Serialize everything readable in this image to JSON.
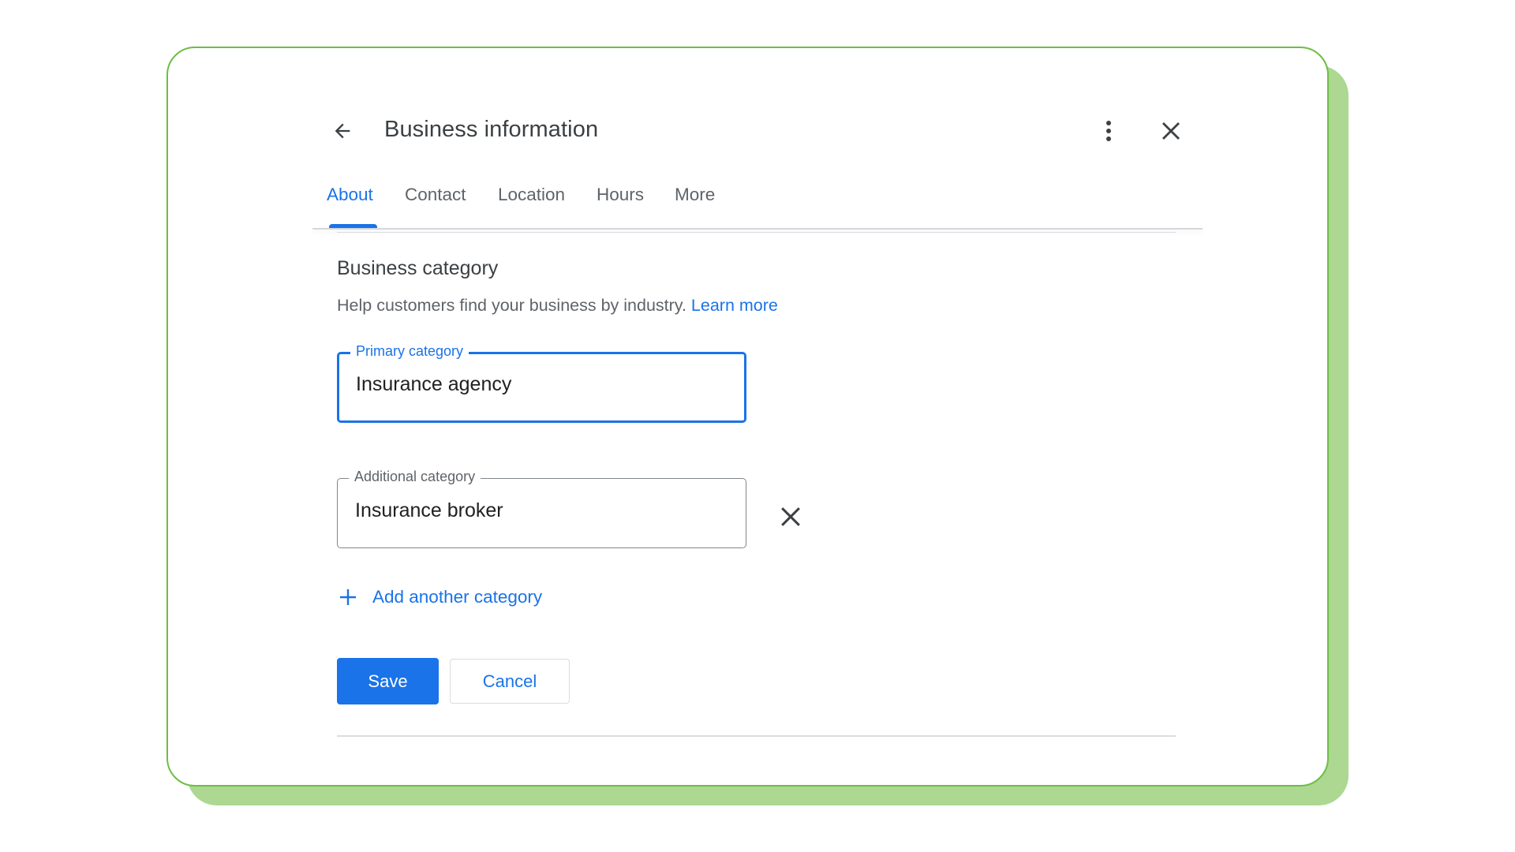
{
  "header": {
    "title": "Business information",
    "back_icon": "arrow-back-icon",
    "more_icon": "more-vert-icon",
    "close_icon": "close-icon"
  },
  "tabs": [
    {
      "label": "About",
      "active": true
    },
    {
      "label": "Contact",
      "active": false
    },
    {
      "label": "Location",
      "active": false
    },
    {
      "label": "Hours",
      "active": false
    },
    {
      "label": "More",
      "active": false
    }
  ],
  "section": {
    "title": "Business category",
    "help_text": "Help customers find your business by industry.",
    "learn_more": "Learn more"
  },
  "fields": {
    "primary": {
      "label": "Primary category",
      "value": "Insurance agency"
    },
    "additional": {
      "label": "Additional category",
      "value": "Insurance broker",
      "remove_icon": "close-icon"
    }
  },
  "add_category": {
    "label": "Add another category",
    "icon": "plus-icon"
  },
  "actions": {
    "save": "Save",
    "cancel": "Cancel"
  },
  "colors": {
    "accent": "#1a73e8",
    "frame_border": "#6dbd45",
    "frame_shadow": "#acd891",
    "text_primary": "#3c4043",
    "text_secondary": "#5f6368"
  }
}
